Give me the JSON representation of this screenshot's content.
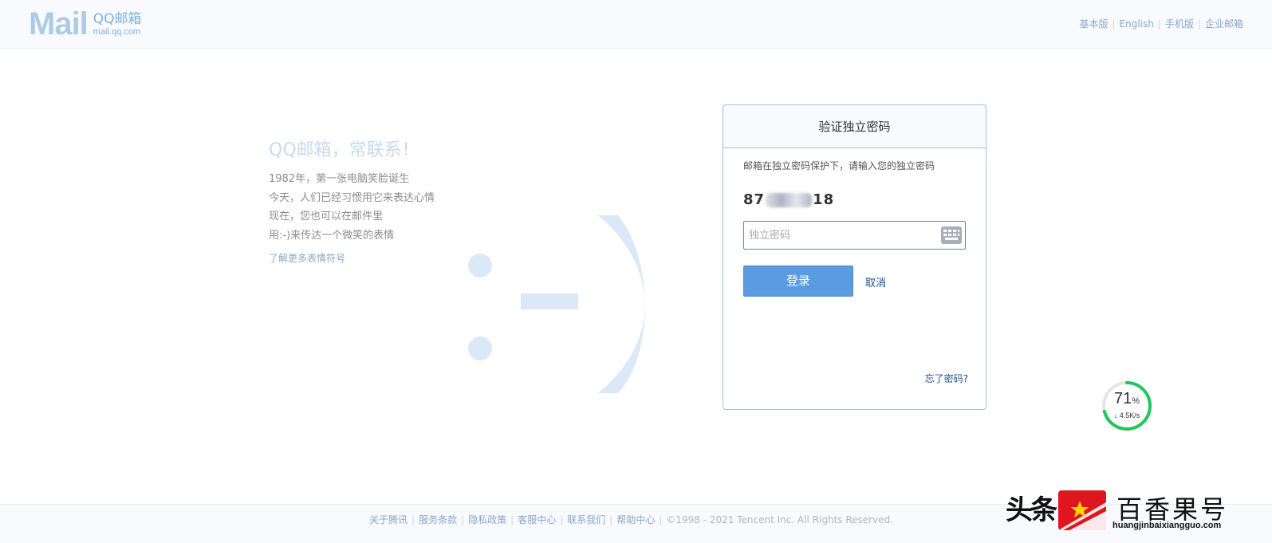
{
  "header": {
    "logo_mail": "Mail",
    "logo_qq": "QQ邮箱",
    "logo_url": "mail.qq.com",
    "links": [
      "基本版",
      "English",
      "手机版",
      "企业邮箱"
    ]
  },
  "intro": {
    "slogan": "QQ邮箱，常联系！",
    "lines": [
      "1982年，第一张电脑笑脸诞生",
      "今天，人们已经习惯用它来表达心情",
      "现在，您也可以在邮件里",
      "用:-)来传达一个微笑的表情"
    ],
    "more_link": "了解更多表情符号"
  },
  "login": {
    "title": "验证独立密码",
    "tip": "邮箱在独立密码保护下，请输入您的独立密码",
    "account_prefix": "87",
    "account_suffix": "18",
    "password_placeholder": "独立密码",
    "login_button": "登录",
    "cancel_link": "取消",
    "forget_link": "忘了密码?"
  },
  "speed_widget": {
    "percent": "71",
    "percent_unit": "%",
    "rate": "↓ 4.5K/s",
    "ring_progress": 0.71
  },
  "footer": {
    "links": [
      "关于腾讯",
      "服务条款",
      "隐私政策",
      "客服中心",
      "联系我们",
      "帮助中心"
    ],
    "copyright": "©1998 - 2021 Tencent Inc. All Rights Reserved."
  },
  "watermark": {
    "left_text": "头条",
    "right_text": "百香果号",
    "url": "huangjinbaixiangguo.com"
  },
  "colors": {
    "accent": "#5a9be2",
    "link": "#1e4f8c",
    "header_bg": "#f8fafd",
    "smiley": "#dbe8f8",
    "speed_ring": "#22c55e"
  }
}
